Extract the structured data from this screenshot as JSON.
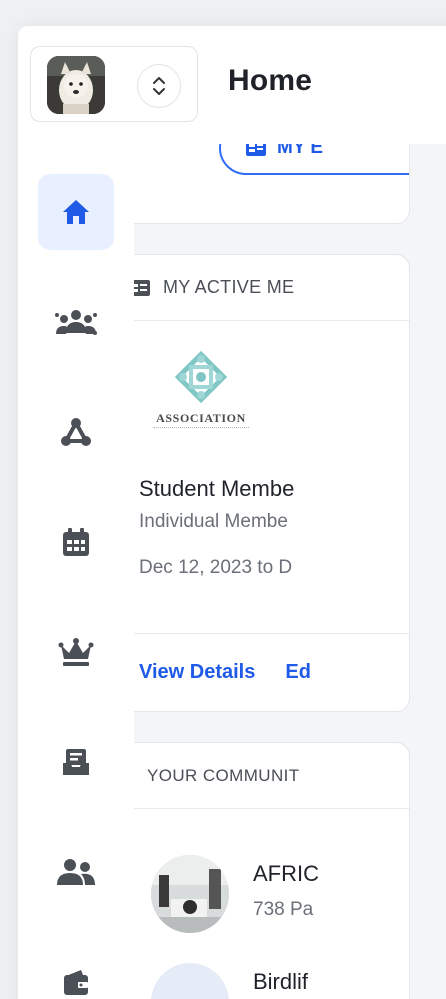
{
  "header": {
    "page_title": "Home",
    "avatar_icon": "dog-photo-avatar",
    "switch_icon": "chevron-updown-icon"
  },
  "sidebar": {
    "items": [
      {
        "name": "home",
        "icon": "home-icon",
        "active": true
      },
      {
        "name": "members",
        "icon": "group-icon",
        "active": false
      },
      {
        "name": "network",
        "icon": "network-icon",
        "active": false
      },
      {
        "name": "events",
        "icon": "calendar-icon",
        "active": false
      },
      {
        "name": "memberships",
        "icon": "crown-icon",
        "active": false
      },
      {
        "name": "inbox",
        "icon": "inbox-icon",
        "active": false
      },
      {
        "name": "connections",
        "icon": "people-icon",
        "active": false
      },
      {
        "name": "wallet",
        "icon": "wallet-icon",
        "active": false
      }
    ]
  },
  "top_card": {
    "button_label": "MY E"
  },
  "membership_card": {
    "header_label": "MY ACTIVE ME",
    "logo_text": "ASSOCIATION",
    "title": "Student Membe",
    "subtitle": "Individual Membe",
    "date_range": "Dec 12, 2023 to D",
    "view_details": "View Details",
    "edit": "Ed"
  },
  "communities_card": {
    "header_label": "YOUR COMMUNIT",
    "items": [
      {
        "name": "AFRIC",
        "meta": "738 Pa"
      },
      {
        "name": "Birdlif",
        "meta": ""
      }
    ]
  },
  "colors": {
    "accent": "#2f6df6",
    "active_bg": "#e8efff",
    "icon_gray": "#4b4f56",
    "teal_logo": "#7fc6c6"
  }
}
